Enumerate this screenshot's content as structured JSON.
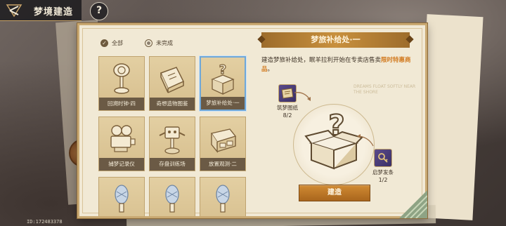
{
  "header": {
    "title": "梦境建造",
    "help_label": "?"
  },
  "footer": {
    "id_text": "ID:172483378"
  },
  "filters": [
    {
      "label": "全部",
      "checked": true
    },
    {
      "label": "未完成",
      "checked": false
    }
  ],
  "items": [
    {
      "label": "回溯时钟·四",
      "icon": "hourglass-icon",
      "selected": false
    },
    {
      "label": "奇想造物图鉴",
      "icon": "book-icon",
      "selected": false
    },
    {
      "label": "梦旅补给处·一",
      "icon": "mystery-box-icon",
      "selected": true
    },
    {
      "label": "捕梦记录仪",
      "icon": "projector-icon",
      "selected": false
    },
    {
      "label": "存盘训练场",
      "icon": "training-dummy-icon",
      "selected": false
    },
    {
      "label": "放置观测·二",
      "icon": "machine-icon",
      "selected": false
    },
    {
      "label": "",
      "icon": "crystal-lamp-icon",
      "selected": false
    },
    {
      "label": "",
      "icon": "crystal-lamp-icon",
      "selected": false
    },
    {
      "label": "",
      "icon": "crystal-lamp-icon",
      "selected": false
    }
  ],
  "detail": {
    "title": "梦旅补给处·一",
    "desc_plain": "建造梦旅补给处，眠羊拉利开始在专卖店售卖",
    "desc_highlight": "限时特惠商品",
    "desc_end": "。",
    "watermark": "DREAMS FLOAT SOFTLY NEAR THE SHORE",
    "materials": [
      {
        "name": "筑梦图纸",
        "count": "8/2",
        "icon": "blueprint-icon"
      },
      {
        "name": "启梦发条",
        "count": "1/2",
        "icon": "key-icon"
      }
    ],
    "build_label": "建造"
  },
  "colors": {
    "accent": "#c8903e",
    "highlight": "#d27a1f",
    "selected_border": "#6fa8d9",
    "panel_bg": "#f1e9d5"
  }
}
